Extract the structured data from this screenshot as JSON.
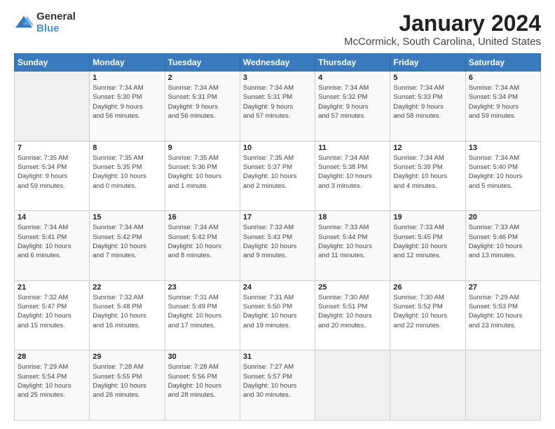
{
  "logo": {
    "general": "General",
    "blue": "Blue"
  },
  "title": "January 2024",
  "subtitle": "McCormick, South Carolina, United States",
  "days_header": [
    "Sunday",
    "Monday",
    "Tuesday",
    "Wednesday",
    "Thursday",
    "Friday",
    "Saturday"
  ],
  "weeks": [
    [
      {
        "num": "",
        "info": ""
      },
      {
        "num": "1",
        "info": "Sunrise: 7:34 AM\nSunset: 5:30 PM\nDaylight: 9 hours\nand 56 minutes."
      },
      {
        "num": "2",
        "info": "Sunrise: 7:34 AM\nSunset: 5:31 PM\nDaylight: 9 hours\nand 56 minutes."
      },
      {
        "num": "3",
        "info": "Sunrise: 7:34 AM\nSunset: 5:31 PM\nDaylight: 9 hours\nand 57 minutes."
      },
      {
        "num": "4",
        "info": "Sunrise: 7:34 AM\nSunset: 5:32 PM\nDaylight: 9 hours\nand 57 minutes."
      },
      {
        "num": "5",
        "info": "Sunrise: 7:34 AM\nSunset: 5:33 PM\nDaylight: 9 hours\nand 58 minutes."
      },
      {
        "num": "6",
        "info": "Sunrise: 7:34 AM\nSunset: 5:34 PM\nDaylight: 9 hours\nand 59 minutes."
      }
    ],
    [
      {
        "num": "7",
        "info": "Sunrise: 7:35 AM\nSunset: 5:34 PM\nDaylight: 9 hours\nand 59 minutes."
      },
      {
        "num": "8",
        "info": "Sunrise: 7:35 AM\nSunset: 5:35 PM\nDaylight: 10 hours\nand 0 minutes."
      },
      {
        "num": "9",
        "info": "Sunrise: 7:35 AM\nSunset: 5:36 PM\nDaylight: 10 hours\nand 1 minute."
      },
      {
        "num": "10",
        "info": "Sunrise: 7:35 AM\nSunset: 5:37 PM\nDaylight: 10 hours\nand 2 minutes."
      },
      {
        "num": "11",
        "info": "Sunrise: 7:34 AM\nSunset: 5:38 PM\nDaylight: 10 hours\nand 3 minutes."
      },
      {
        "num": "12",
        "info": "Sunrise: 7:34 AM\nSunset: 5:39 PM\nDaylight: 10 hours\nand 4 minutes."
      },
      {
        "num": "13",
        "info": "Sunrise: 7:34 AM\nSunset: 5:40 PM\nDaylight: 10 hours\nand 5 minutes."
      }
    ],
    [
      {
        "num": "14",
        "info": "Sunrise: 7:34 AM\nSunset: 5:41 PM\nDaylight: 10 hours\nand 6 minutes."
      },
      {
        "num": "15",
        "info": "Sunrise: 7:34 AM\nSunset: 5:42 PM\nDaylight: 10 hours\nand 7 minutes."
      },
      {
        "num": "16",
        "info": "Sunrise: 7:34 AM\nSunset: 5:42 PM\nDaylight: 10 hours\nand 8 minutes."
      },
      {
        "num": "17",
        "info": "Sunrise: 7:33 AM\nSunset: 5:43 PM\nDaylight: 10 hours\nand 9 minutes."
      },
      {
        "num": "18",
        "info": "Sunrise: 7:33 AM\nSunset: 5:44 PM\nDaylight: 10 hours\nand 11 minutes."
      },
      {
        "num": "19",
        "info": "Sunrise: 7:33 AM\nSunset: 5:45 PM\nDaylight: 10 hours\nand 12 minutes."
      },
      {
        "num": "20",
        "info": "Sunrise: 7:33 AM\nSunset: 5:46 PM\nDaylight: 10 hours\nand 13 minutes."
      }
    ],
    [
      {
        "num": "21",
        "info": "Sunrise: 7:32 AM\nSunset: 5:47 PM\nDaylight: 10 hours\nand 15 minutes."
      },
      {
        "num": "22",
        "info": "Sunrise: 7:32 AM\nSunset: 5:48 PM\nDaylight: 10 hours\nand 16 minutes."
      },
      {
        "num": "23",
        "info": "Sunrise: 7:31 AM\nSunset: 5:49 PM\nDaylight: 10 hours\nand 17 minutes."
      },
      {
        "num": "24",
        "info": "Sunrise: 7:31 AM\nSunset: 5:50 PM\nDaylight: 10 hours\nand 19 minutes."
      },
      {
        "num": "25",
        "info": "Sunrise: 7:30 AM\nSunset: 5:51 PM\nDaylight: 10 hours\nand 20 minutes."
      },
      {
        "num": "26",
        "info": "Sunrise: 7:30 AM\nSunset: 5:52 PM\nDaylight: 10 hours\nand 22 minutes."
      },
      {
        "num": "27",
        "info": "Sunrise: 7:29 AM\nSunset: 5:53 PM\nDaylight: 10 hours\nand 23 minutes."
      }
    ],
    [
      {
        "num": "28",
        "info": "Sunrise: 7:29 AM\nSunset: 5:54 PM\nDaylight: 10 hours\nand 25 minutes."
      },
      {
        "num": "29",
        "info": "Sunrise: 7:28 AM\nSunset: 5:55 PM\nDaylight: 10 hours\nand 26 minutes."
      },
      {
        "num": "30",
        "info": "Sunrise: 7:28 AM\nSunset: 5:56 PM\nDaylight: 10 hours\nand 28 minutes."
      },
      {
        "num": "31",
        "info": "Sunrise: 7:27 AM\nSunset: 5:57 PM\nDaylight: 10 hours\nand 30 minutes."
      },
      {
        "num": "",
        "info": ""
      },
      {
        "num": "",
        "info": ""
      },
      {
        "num": "",
        "info": ""
      }
    ]
  ]
}
